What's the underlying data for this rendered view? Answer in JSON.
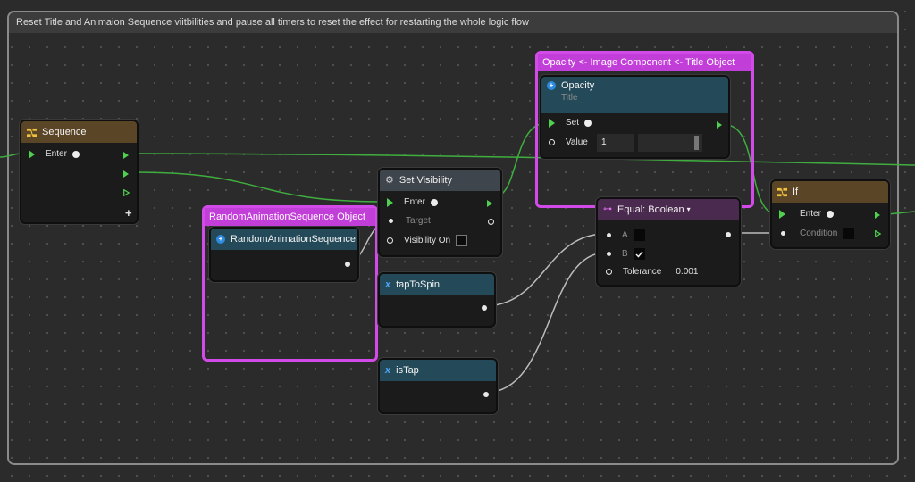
{
  "comment": {
    "title": "Reset Title and Animaion Sequence viitbilities and pause all timers to reset the effect for restarting the whole logic flow"
  },
  "groups": {
    "opacity": "Opacity <- Image Component <- Title Object",
    "random_anim": "RandomAnimationSequence Object"
  },
  "nodes": {
    "sequence": {
      "title": "Sequence",
      "enter": "Enter",
      "icon": "sequence-icon"
    },
    "set_visibility": {
      "title": "Set Visibility",
      "enter": "Enter",
      "target": "Target",
      "visibility_on": "Visibility On",
      "icon": "gear-icon"
    },
    "random_anim": {
      "title": "RandomAnimationSequence",
      "icon": "object-icon"
    },
    "opacity": {
      "title": "Opacity",
      "subtitle": "Title",
      "set": "Set",
      "value_label": "Value",
      "value": "1",
      "icon": "object-icon"
    },
    "equal_boolean": {
      "title": "Equal: Boolean",
      "dropdown_icon": "caret-down-icon",
      "a": "A",
      "b": "B",
      "tolerance_label": "Tolerance",
      "tolerance_value": "0.001"
    },
    "tap_to_spin": {
      "title": "tapToSpin",
      "icon": "variable-icon"
    },
    "is_tap": {
      "title": "isTap",
      "icon": "variable-icon"
    },
    "if": {
      "title": "If",
      "enter": "Enter",
      "condition": "Condition",
      "icon": "sequence-icon"
    }
  },
  "colors": {
    "exec_wire": "#3fae3f",
    "data_wire": "#bcbcbc",
    "group_border": "#d24be8",
    "header_brown": "#5b4527",
    "header_teal": "#244a59",
    "header_purple": "#4a2a4e"
  }
}
